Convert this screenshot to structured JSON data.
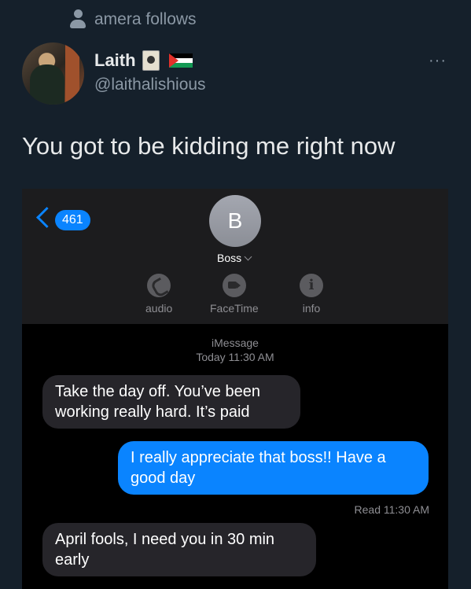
{
  "follows": {
    "text": "amera follows"
  },
  "author": {
    "name": "Laith",
    "handle": "@laithalishious",
    "more": "···"
  },
  "tweet": {
    "text": "You got to be kidding me right now"
  },
  "screenshot": {
    "back_count": "461",
    "contact_initial": "B",
    "contact_name": "Boss",
    "actions": [
      {
        "label": "audio",
        "icon": "phone-icon"
      },
      {
        "label": "FaceTime",
        "icon": "video-icon"
      },
      {
        "label": "info",
        "icon": "info-icon"
      }
    ],
    "service": "iMessage",
    "timestamp": "Today 11:30 AM",
    "messages": [
      {
        "direction": "in",
        "text": "Take the day off. You’ve been working really hard. It’s paid"
      },
      {
        "direction": "out",
        "text": "I really appreciate that boss!! Have a good day"
      },
      {
        "direction": "in",
        "text": "April fools, I need you in 30 min early"
      }
    ],
    "read_receipt": "Read 11:30 AM"
  },
  "colors": {
    "background": "#15202b",
    "imessage_blue": "#0a84ff",
    "incoming_bubble": "#26252a"
  }
}
